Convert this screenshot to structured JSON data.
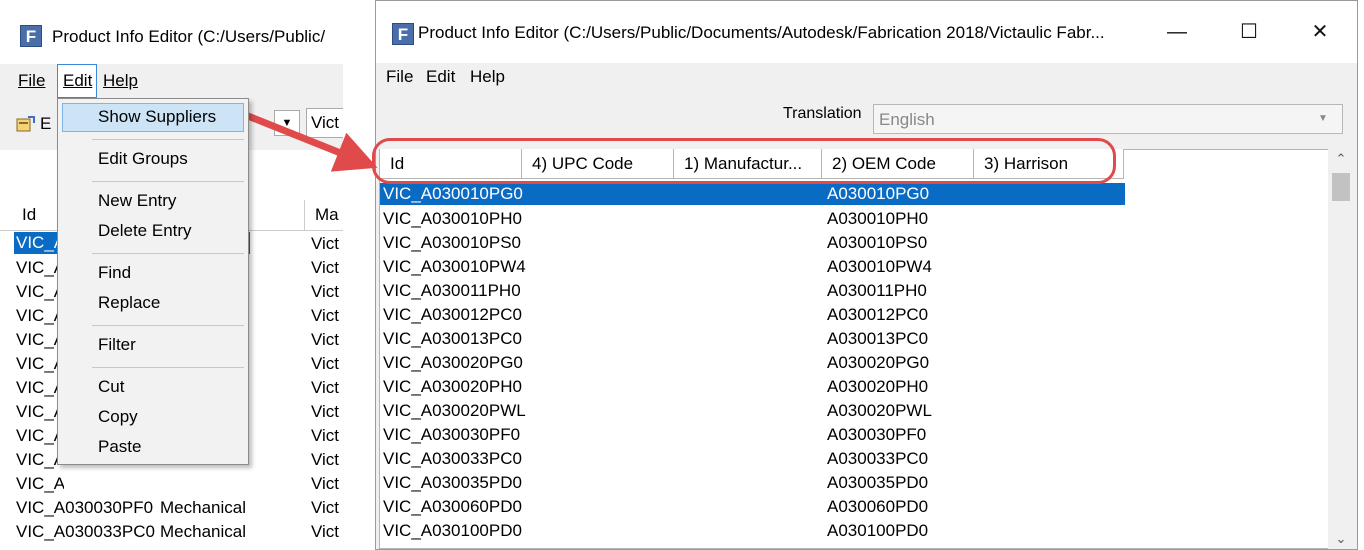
{
  "left_window": {
    "icon_letter": "F",
    "title": "Product Info Editor (C:/Users/Public/",
    "menu": {
      "file": "File",
      "edit": "Edit",
      "help": "Help"
    },
    "toolbar_text": "E",
    "toolbar_field": "Vict",
    "list_header_id": "Id",
    "list_header_ma": "Ma",
    "rows": [
      {
        "id": "VIC_A",
        "vi": "Vict"
      },
      {
        "id": "VIC_A",
        "vi": "Vict"
      },
      {
        "id": "VIC_A",
        "vi": "Vict"
      },
      {
        "id": "VIC_A",
        "vi": "Vict"
      },
      {
        "id": "VIC_A",
        "vi": "Vict"
      },
      {
        "id": "VIC_A",
        "vi": "Vict"
      },
      {
        "id": "VIC_A",
        "vi": "Vict"
      },
      {
        "id": "VIC_A",
        "vi": "Vict"
      },
      {
        "id": "VIC_A",
        "vi": "Vict"
      },
      {
        "id": "VIC_A",
        "vi": "Vict"
      },
      {
        "id": "VIC_A",
        "vi": "Vict"
      },
      {
        "id": "VIC_A030030PF0",
        "mech": "Mechanical",
        "vi": "Vict"
      },
      {
        "id": "VIC_A030033PC0",
        "mech": "Mechanical",
        "vi": "Vict"
      }
    ]
  },
  "edit_menu": {
    "show_suppliers": "Show Suppliers",
    "edit_groups": "Edit Groups",
    "new_entry": "New Entry",
    "delete_entry": "Delete Entry",
    "find": "Find",
    "replace": "Replace",
    "filter": "Filter",
    "cut": "Cut",
    "copy": "Copy",
    "paste": "Paste"
  },
  "right_window": {
    "icon_letter": "F",
    "title": "Product Info Editor (C:/Users/Public/Documents/Autodesk/Fabrication 2018/Victaulic Fabr...",
    "controls": {
      "minimize": "—",
      "maximize": "☐",
      "close": "✕"
    },
    "menu": {
      "file": "File",
      "edit": "Edit",
      "help": "Help"
    },
    "translation_label": "Translation",
    "translation_value": "English",
    "columns": [
      "Id",
      "4) UPC Code",
      "1) Manufactur...",
      "2) OEM Code",
      "3) Harrison"
    ],
    "rows": [
      {
        "id": "VIC_A030010PG0",
        "oem": "A030010PG0"
      },
      {
        "id": "VIC_A030010PH0",
        "oem": "A030010PH0"
      },
      {
        "id": "VIC_A030010PS0",
        "oem": "A030010PS0"
      },
      {
        "id": "VIC_A030010PW4",
        "oem": "A030010PW4"
      },
      {
        "id": "VIC_A030011PH0",
        "oem": "A030011PH0"
      },
      {
        "id": "VIC_A030012PC0",
        "oem": "A030012PC0"
      },
      {
        "id": "VIC_A030013PC0",
        "oem": "A030013PC0"
      },
      {
        "id": "VIC_A030020PG0",
        "oem": "A030020PG0"
      },
      {
        "id": "VIC_A030020PH0",
        "oem": "A030020PH0"
      },
      {
        "id": "VIC_A030020PWL",
        "oem": "A030020PWL"
      },
      {
        "id": "VIC_A030030PF0",
        "oem": "A030030PF0"
      },
      {
        "id": "VIC_A030033PC0",
        "oem": "A030033PC0"
      },
      {
        "id": "VIC_A030035PD0",
        "oem": "A030035PD0"
      },
      {
        "id": "VIC_A030060PD0",
        "oem": "A030060PD0"
      },
      {
        "id": "VIC_A030100PD0",
        "oem": "A030100PD0"
      }
    ]
  },
  "colors": {
    "selection": "#0a6bc4",
    "highlight": "#e04a4a",
    "menu_hover": "#cde4f7"
  }
}
